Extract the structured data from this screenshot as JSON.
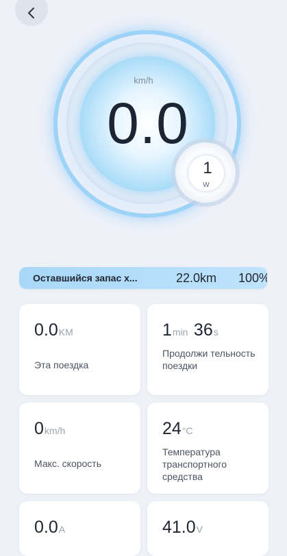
{
  "speed": {
    "value": "0.0",
    "unit": "km/h"
  },
  "power": {
    "value": "1",
    "unit": "W"
  },
  "range": {
    "label": "Оставшийся запас х...",
    "distance": "22.0km",
    "percent": "100%",
    "fill_fraction": 1.0
  },
  "cards": [
    {
      "value": "0.0",
      "unit": "KM",
      "label": "Эта поездка"
    },
    {
      "value_min": "1",
      "unit_min": "min",
      "value_sec": "36",
      "unit_sec": "s",
      "label": "Продолжи тельность поездки"
    },
    {
      "value": "0",
      "unit": "km/h",
      "label": "Макс. скорость"
    },
    {
      "value": "24",
      "unit": "°C",
      "label": "Температура транспортного средства"
    },
    {
      "value": "0.0",
      "unit": "A"
    },
    {
      "value": "41.0",
      "unit": "V"
    }
  ],
  "icons": {
    "back": "back-arrow-icon"
  }
}
